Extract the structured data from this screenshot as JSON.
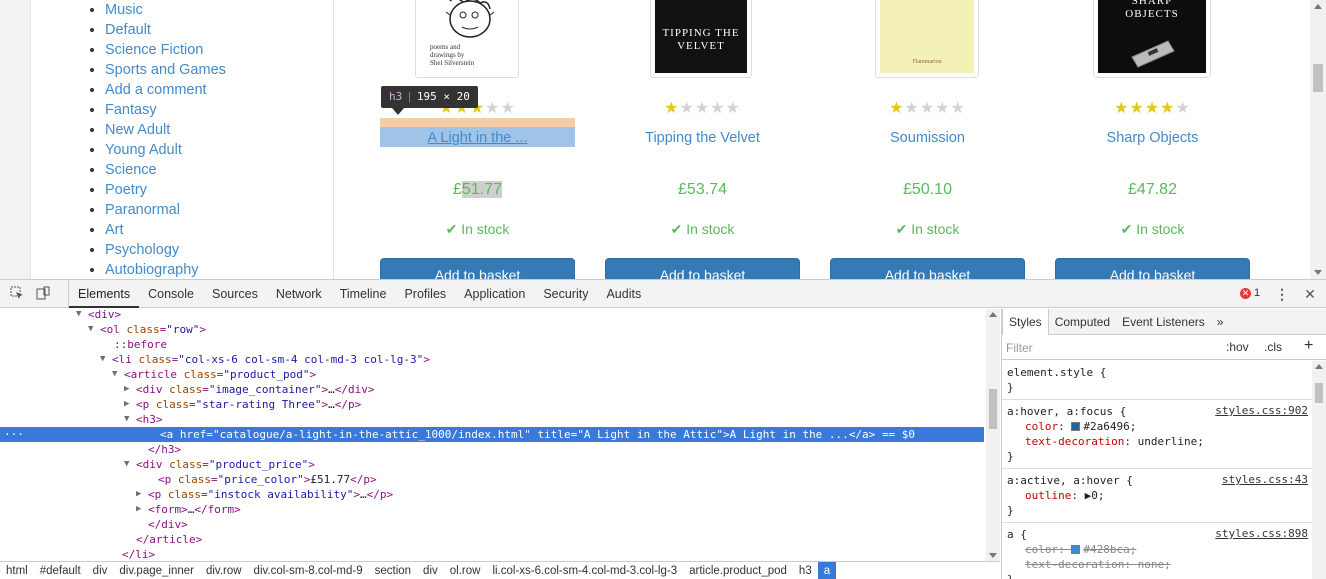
{
  "sidebar": {
    "categories": [
      "Music",
      "Default",
      "Science Fiction",
      "Sports and Games",
      "Add a comment",
      "Fantasy",
      "New Adult",
      "Young Adult",
      "Science",
      "Poetry",
      "Paranormal",
      "Art",
      "Psychology",
      "Autobiography"
    ]
  },
  "products": [
    {
      "title": "A Light in the ...",
      "rating": 3,
      "price": "£51.77",
      "price_currency": "£",
      "price_value": "51.77",
      "stock": "In stock",
      "button": "Add to basket",
      "cover_caption": "poems and drawings by",
      "cover_author": "Shel Silverstein"
    },
    {
      "title": "Tipping the Velvet",
      "rating": 1,
      "price": "£53.74",
      "stock": "In stock",
      "button": "Add to basket",
      "cover_title": "TIPPING THE VELVET"
    },
    {
      "title": "Soumission",
      "rating": 1,
      "price": "£50.10",
      "stock": "In stock",
      "button": "Add to basket",
      "cover_publisher": "Flammarion"
    },
    {
      "title": "Sharp Objects",
      "rating": 4,
      "price": "£47.82",
      "stock": "In stock",
      "button": "Add to basket",
      "cover_title": "SHARP OBJECTS"
    }
  ],
  "tooltip": {
    "tag": "h3",
    "size": "195 × 20"
  },
  "devtools": {
    "tabs": [
      "Elements",
      "Console",
      "Sources",
      "Network",
      "Timeline",
      "Profiles",
      "Application",
      "Security",
      "Audits"
    ],
    "active_tab": "Elements",
    "error_count": "1",
    "dom_lines": [
      {
        "text": "<div>",
        "tri": "▼"
      },
      {
        "text": "<ol class=\"row\">",
        "tri": "▼"
      },
      {
        "text": "::before",
        "tri": ""
      },
      {
        "text": "<li class=\"col-xs-6 col-sm-4 col-md-3 col-lg-3\">",
        "tri": "▼"
      },
      {
        "text": "<article class=\"product_pod\">",
        "tri": "▼"
      },
      {
        "text": "<div class=\"image_container\">…</div>",
        "tri": "▶"
      },
      {
        "text": "<p class=\"star-rating Three\">…</p>",
        "tri": "▶"
      },
      {
        "text": "<h3>",
        "tri": "▼"
      },
      {
        "text": "<a href=\"catalogue/a-light-in-the-attic_1000/index.html\" title=\"A Light in the Attic\">A Light in the ...</a> == $0",
        "tri": "···"
      },
      {
        "text": "</h3>",
        "tri": ""
      },
      {
        "text": "<div class=\"product_price\">",
        "tri": "▼"
      },
      {
        "text": "<p class=\"price_color\">£51.77</p>",
        "tri": ""
      },
      {
        "text": "<p class=\"instock availability\">…</p>",
        "tri": "▶"
      },
      {
        "text": "<form>…</form>",
        "tri": "▶"
      },
      {
        "text": "</div>",
        "tri": ""
      },
      {
        "text": "</article>",
        "tri": ""
      },
      {
        "text": "</li>",
        "tri": ""
      }
    ],
    "breadcrumbs": [
      "html",
      "#default",
      "div",
      "div.page_inner",
      "div.row",
      "div.col-sm-8.col-md-9",
      "section",
      "div",
      "ol.row",
      "li.col-xs-6.col-sm-4.col-md-3.col-lg-3",
      "article.product_pod",
      "h3",
      "a"
    ],
    "styles": {
      "tabs": [
        "Styles",
        "Computed",
        "Event Listeners",
        "»"
      ],
      "filter_placeholder": "Filter",
      "hov": ":hov",
      "cls": ".cls",
      "add": "+",
      "rules": [
        {
          "selector": "element.style {",
          "source": "",
          "decls": [],
          "close": "}"
        },
        {
          "selector": "a:hover, a:focus {",
          "source": "styles.css:902",
          "decls": [
            {
              "prop": "color",
              "val": "#2a6496;",
              "swatch": "#2a6496",
              "struck": false
            },
            {
              "prop": "text-decoration",
              "val": "underline;",
              "swatch": "",
              "struck": false
            }
          ],
          "close": "}"
        },
        {
          "selector": "a:active, a:hover {",
          "source": "styles.css:43",
          "decls": [
            {
              "prop": "outline",
              "val": "▶0;",
              "swatch": "",
              "struck": false
            }
          ],
          "close": "}"
        },
        {
          "selector": "a {",
          "source": "styles.css:898",
          "decls": [
            {
              "prop": "color",
              "val": "#428bca;",
              "swatch": "#428bca",
              "struck": true
            },
            {
              "prop": "text-decoration",
              "val": "none;",
              "swatch": "",
              "struck": true
            }
          ],
          "close": "}"
        }
      ]
    }
  },
  "colors": {
    "link": "#428bca",
    "price": "#5cb85c",
    "button": "#337ab7",
    "star_on": "#e1c71d",
    "star_off": "#d3d3d3",
    "devtools_selection": "#3879d9"
  }
}
